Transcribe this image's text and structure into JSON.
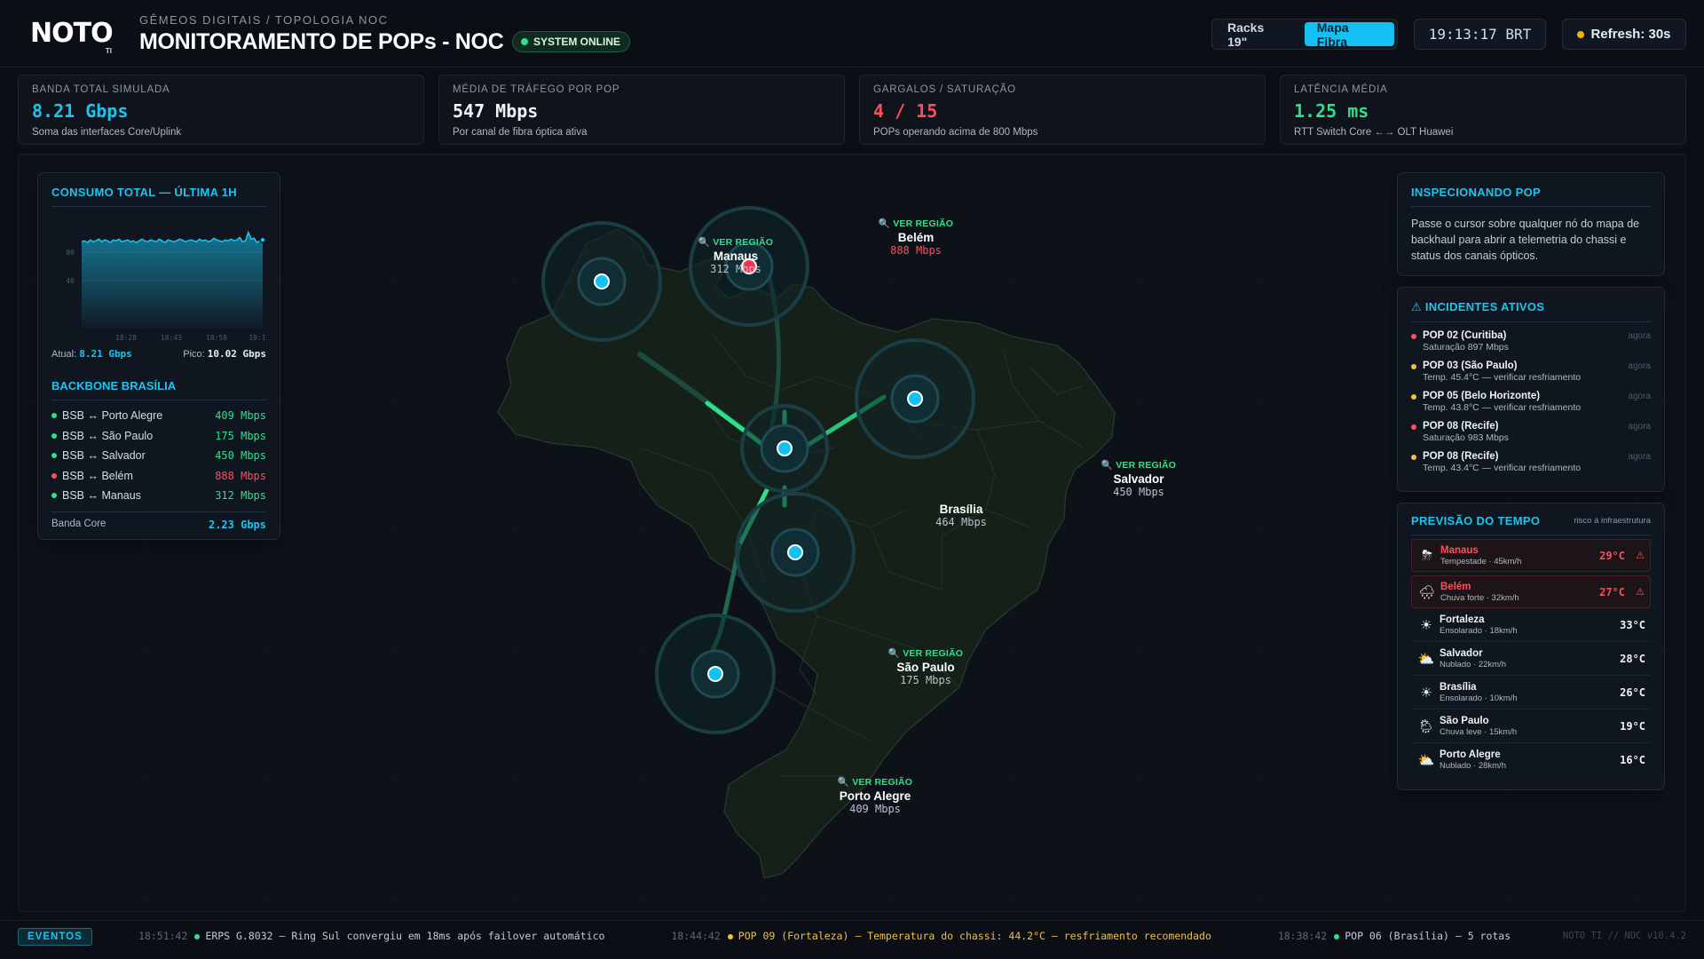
{
  "header": {
    "logo_text": "NOTO",
    "logo_sub": "TI",
    "breadcrumb": "GÊMEOS DIGITAIS / TOPOLOGIA NOC",
    "title": "MONITORAMENTO DE POPs - NOC",
    "status_label": "SYSTEM ONLINE",
    "views": [
      {
        "label": "Racks 19\"",
        "active": false
      },
      {
        "label": "Mapa Fibra",
        "active": true
      }
    ],
    "clock": "19:13:17 BRT",
    "refresh_label": "Refresh: 30s"
  },
  "kpis": [
    {
      "label": "BANDA TOTAL SIMULADA",
      "value": "8.21 Gbps",
      "sub": "Soma das interfaces Core/Uplink",
      "color": "#19c6f0"
    },
    {
      "label": "MÉDIA DE TRÁFEGO POR POP",
      "value": "547 Mbps",
      "sub": "Por canal de fibra óptica ativa",
      "color": "#f2f5f8"
    },
    {
      "label": "GARGALOS / SATURAÇÃO",
      "value": "4 / 15",
      "sub": "POPs operando acima de 800 Mbps",
      "color": "#ff4d5e"
    },
    {
      "label": "LATÊNCIA MÉDIA",
      "value": "1.25 ms",
      "sub": "RTT Switch Core ←→ OLT Huawei",
      "color": "#2ee08c"
    }
  ],
  "consumo": {
    "title": "CONSUMO TOTAL — ÚLTIMA 1H",
    "y_ticks": [
      "80",
      "40"
    ],
    "x_ticks": [
      "18:28",
      "18:43",
      "18:58",
      "19:1"
    ],
    "current_label": "Atual:",
    "current_value": "8.21 Gbps",
    "peak_label": "Pico:",
    "peak_value": "10.02 Gbps"
  },
  "chart_data": {
    "type": "area",
    "title": "CONSUMO TOTAL — ÚLTIMA 1H",
    "xlabel": "",
    "ylabel": "",
    "ylim": [
      0,
      100
    ],
    "x_ticks": [
      "18:28",
      "18:43",
      "18:58",
      "19:1"
    ],
    "values": [
      79,
      80,
      78,
      81,
      79,
      80,
      82,
      79,
      81,
      80,
      78,
      81,
      80,
      82,
      79,
      80,
      81,
      79,
      80,
      78,
      80,
      82,
      80,
      79,
      81,
      80,
      79,
      82,
      80,
      78,
      81,
      80,
      79,
      80,
      82,
      81,
      79,
      80,
      81,
      80,
      79,
      82,
      80,
      81,
      79,
      80,
      83,
      81,
      80,
      79,
      81,
      80,
      82,
      80,
      81,
      84,
      79,
      80,
      90,
      82,
      83,
      78,
      80,
      81
    ]
  },
  "backbone": {
    "title": "BACKBONE BRASÍLIA",
    "links": [
      {
        "name": "BSB ↔ Porto Alegre",
        "value": "409 Mbps",
        "status": "ok"
      },
      {
        "name": "BSB ↔ São Paulo",
        "value": "175 Mbps",
        "status": "ok"
      },
      {
        "name": "BSB ↔ Salvador",
        "value": "450 Mbps",
        "status": "ok"
      },
      {
        "name": "BSB ↔ Belém",
        "value": "888 Mbps",
        "status": "critical"
      },
      {
        "name": "BSB ↔ Manaus",
        "value": "312 Mbps",
        "status": "ok"
      }
    ],
    "total_label": "Banda Core",
    "total_value": "2.23 Gbps"
  },
  "inspect": {
    "title": "INSPECIONANDO POP",
    "text": "Passe o cursor sobre qualquer nó do mapa de backhaul para abrir a telemetria do chassi e status dos canais ópticos."
  },
  "incidents": {
    "title": "⚠ INCIDENTES ATIVOS",
    "items": [
      {
        "name": "POP 02 (Curitiba)",
        "desc": "Saturação 897 Mbps",
        "time": "agora",
        "severity": "critical"
      },
      {
        "name": "POP 03 (São Paulo)",
        "desc": "Temp. 45.4°C — verificar resfriamento",
        "time": "agora",
        "severity": "warning"
      },
      {
        "name": "POP 05 (Belo Horizonte)",
        "desc": "Temp. 43.8°C — verificar resfriamento",
        "time": "agora",
        "severity": "warning"
      },
      {
        "name": "POP 08 (Recife)",
        "desc": "Saturação 983 Mbps",
        "time": "agora",
        "severity": "critical"
      },
      {
        "name": "POP 08 (Recife)",
        "desc": "Temp. 43.4°C — verificar resfriamento",
        "time": "agora",
        "severity": "warning"
      }
    ]
  },
  "weather": {
    "title": "PREVISÃO DO TEMPO",
    "subtitle": "risco à infraestrutura",
    "items": [
      {
        "city": "Manaus",
        "desc": "Tempestade · 45km/h",
        "temp": "29°C",
        "icon": "storm-icon",
        "glyph": "⛈",
        "alert": true,
        "warn": "⚠"
      },
      {
        "city": "Belém",
        "desc": "Chuva forte · 32km/h",
        "temp": "27°C",
        "icon": "heavy-rain-icon",
        "glyph": "🌧",
        "alert": true,
        "warn": "⚠"
      },
      {
        "city": "Fortaleza",
        "desc": "Ensolarado · 18km/h",
        "temp": "33°C",
        "icon": "sun-icon",
        "glyph": "☀",
        "alert": false,
        "warn": ""
      },
      {
        "city": "Salvador",
        "desc": "Nublado · 22km/h",
        "temp": "28°C",
        "icon": "partly-cloudy-icon",
        "glyph": "⛅",
        "alert": false,
        "warn": ""
      },
      {
        "city": "Brasília",
        "desc": "Ensolarado · 10km/h",
        "temp": "26°C",
        "icon": "sun-icon",
        "glyph": "☀",
        "alert": false,
        "warn": ""
      },
      {
        "city": "São Paulo",
        "desc": "Chuva leve · 15km/h",
        "temp": "19°C",
        "icon": "light-rain-icon",
        "glyph": "🌦",
        "alert": false,
        "warn": ""
      },
      {
        "city": "Porto Alegre",
        "desc": "Nublado · 28km/h",
        "temp": "16°C",
        "icon": "partly-cloudy-icon",
        "glyph": "⛅",
        "alert": false,
        "warn": ""
      }
    ]
  },
  "pops": [
    {
      "id": "manaus",
      "region_label": "🔍 VER REGIÃO",
      "name": "Manaus",
      "traffic": "312 Mbps",
      "status": "ok"
    },
    {
      "id": "belem",
      "region_label": "🔍 VER REGIÃO",
      "name": "Belém",
      "traffic": "888 Mbps",
      "status": "critical"
    },
    {
      "id": "salvador",
      "region_label": "🔍 VER REGIÃO",
      "name": "Salvador",
      "traffic": "450 Mbps",
      "status": "ok"
    },
    {
      "id": "brasilia",
      "region_label": "",
      "name": "Brasília",
      "traffic": "464 Mbps",
      "status": "ok"
    },
    {
      "id": "saopaulo",
      "region_label": "🔍 VER REGIÃO",
      "name": "São Paulo",
      "traffic": "175 Mbps",
      "status": "ok"
    },
    {
      "id": "portoalegre",
      "region_label": "🔍 VER REGIÃO",
      "name": "Porto Alegre",
      "traffic": "409 Mbps",
      "status": "ok"
    }
  ],
  "footer": {
    "events_label": "EVENTOS",
    "events": [
      {
        "time": "18:51:42",
        "text": "ERPS G.8032 — Ring Sul convergiu em 18ms após failover automático",
        "severity": "ok"
      },
      {
        "time": "18:44:42",
        "text": "POP 09 (Fortaleza) — Temperatura do chassi: 44.2°C — resfriamento recomendado",
        "severity": "warn"
      },
      {
        "time": "18:38:42",
        "text": "POP 06 (Brasília) — 5 rotas",
        "severity": "ok"
      }
    ],
    "version": "NOTO TI // NOC v10.4.2"
  },
  "colors": {
    "accent": "#19c6f0",
    "ok": "#2ee08c",
    "critical": "#ff4d5e",
    "warning": "#f0c040"
  }
}
